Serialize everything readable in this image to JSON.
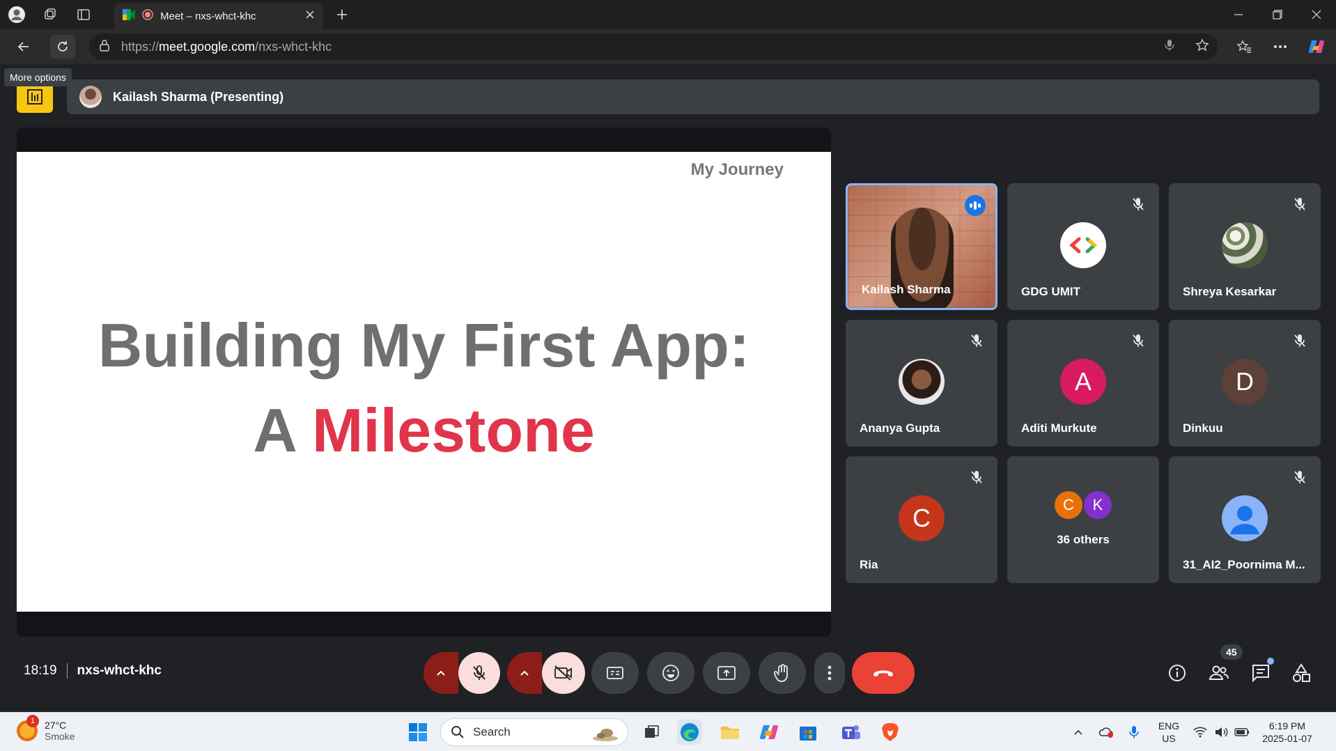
{
  "browser": {
    "tab_title": "Meet – nxs-whct-khc",
    "url_prefix": "https://",
    "url_host": "meet.google.com",
    "url_path": "/nxs-whct-khc",
    "tooltip": "More options"
  },
  "meet": {
    "presenting_label": "Kailash Sharma (Presenting)",
    "slide": {
      "tag": "My Journey",
      "line1": "Building My First App:",
      "line2_a": "A",
      "line2_b": "Milestone"
    },
    "participants": [
      {
        "name": "Kailash Sharma",
        "speaking": true
      },
      {
        "name": "GDG UMIT",
        "muted": true
      },
      {
        "name": "Shreya Kesarkar",
        "muted": true
      },
      {
        "name": "Ananya Gupta",
        "muted": true
      },
      {
        "name": "Aditi Murkute",
        "initial": "A",
        "color": "#d81b60",
        "muted": true
      },
      {
        "name": "Dinkuu",
        "initial": "D",
        "color": "#5d4037",
        "muted": true
      },
      {
        "name": "Ria",
        "initial": "C",
        "color": "#c5351a",
        "muted": true
      },
      {
        "name": "36 others",
        "initials": [
          "C",
          "K"
        ],
        "colors": [
          "#e8710a",
          "#8430ce"
        ]
      },
      {
        "name": "31_AI2_Poornima M...",
        "muted": true
      }
    ],
    "time": "18:19",
    "meeting_code": "nxs-whct-khc",
    "people_count": "45"
  },
  "taskbar": {
    "weather_temp": "27°C",
    "weather_desc": "Smoke",
    "weather_badge": "1",
    "search_placeholder": "Search",
    "lang_1": "ENG",
    "lang_2": "US",
    "time": "6:19 PM",
    "date": "2025-01-07"
  }
}
